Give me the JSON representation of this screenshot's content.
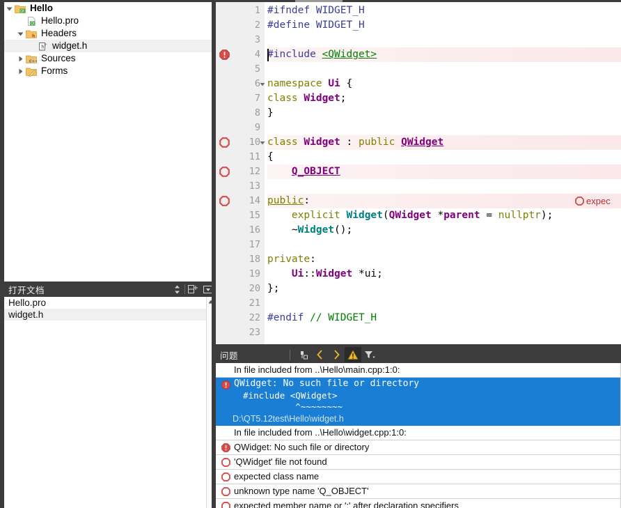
{
  "project_tree": {
    "items": [
      {
        "label": "Hello",
        "icon": "qt-folder-icon",
        "indent": 0,
        "arrow": "expanded",
        "bold": true,
        "selected": false
      },
      {
        "label": "Hello.pro",
        "icon": "qt-pro-file-icon",
        "indent": 1,
        "arrow": "none",
        "bold": false,
        "selected": false
      },
      {
        "label": "Headers",
        "icon": "headers-folder-icon",
        "indent": 1,
        "arrow": "expanded",
        "bold": false,
        "selected": false
      },
      {
        "label": "widget.h",
        "icon": "header-file-icon",
        "indent": 2,
        "arrow": "none",
        "bold": false,
        "selected": true
      },
      {
        "label": "Sources",
        "icon": "sources-folder-icon",
        "indent": 1,
        "arrow": "collapsed",
        "bold": false,
        "selected": false
      },
      {
        "label": "Forms",
        "icon": "forms-folder-icon",
        "indent": 1,
        "arrow": "collapsed",
        "bold": false,
        "selected": false
      }
    ]
  },
  "open_documents": {
    "title": "打开文档",
    "sort_icon": "sort-updown-icon",
    "add_icon": "split-add-icon",
    "menu_icon": "dropdown-box-icon",
    "items": [
      {
        "label": "Hello.pro",
        "selected": false
      },
      {
        "label": "widget.h",
        "selected": true
      }
    ]
  },
  "editor": {
    "filename": "widget.h",
    "caret_line": 4,
    "lines": [
      {
        "num": "1",
        "marker": "none",
        "fold": "none",
        "error": false,
        "tokens": [
          {
            "t": "#ifndef WIDGET_H",
            "c": "t-pre"
          }
        ]
      },
      {
        "num": "2",
        "marker": "none",
        "fold": "none",
        "error": false,
        "tokens": [
          {
            "t": "#define WIDGET_H",
            "c": "t-pre"
          }
        ]
      },
      {
        "num": "3",
        "marker": "none",
        "fold": "none",
        "error": false,
        "tokens": []
      },
      {
        "num": "4",
        "marker": "error-solid",
        "fold": "none",
        "error": true,
        "tokens": [
          {
            "t": "#include ",
            "c": "t-pre"
          },
          {
            "t": "<QWidget>",
            "c": "t-str"
          }
        ]
      },
      {
        "num": "5",
        "marker": "none",
        "fold": "none",
        "error": false,
        "tokens": []
      },
      {
        "num": "6",
        "marker": "none",
        "fold": "expanded",
        "error": false,
        "tokens": [
          {
            "t": "namespace ",
            "c": "t-kw"
          },
          {
            "t": "Ui",
            "c": "t-type"
          },
          {
            "t": " {",
            "c": "t-plain"
          }
        ]
      },
      {
        "num": "7",
        "marker": "none",
        "fold": "none",
        "error": false,
        "tokens": [
          {
            "t": "class ",
            "c": "t-kw"
          },
          {
            "t": "Widget",
            "c": "t-type"
          },
          {
            "t": ";",
            "c": "t-plain"
          }
        ]
      },
      {
        "num": "8",
        "marker": "none",
        "fold": "none",
        "error": false,
        "tokens": [
          {
            "t": "}",
            "c": "t-plain"
          }
        ]
      },
      {
        "num": "9",
        "marker": "none",
        "fold": "none",
        "error": false,
        "tokens": []
      },
      {
        "num": "10",
        "marker": "error-hollow",
        "fold": "expanded",
        "error": true,
        "tokens": [
          {
            "t": "class ",
            "c": "t-kw"
          },
          {
            "t": "Widget",
            "c": "t-type"
          },
          {
            "t": " : ",
            "c": "t-plain"
          },
          {
            "t": "public ",
            "c": "t-kw"
          },
          {
            "t": "QWidget",
            "c": "t-typeu"
          }
        ]
      },
      {
        "num": "11",
        "marker": "none",
        "fold": "none",
        "error": false,
        "tokens": [
          {
            "t": "{",
            "c": "t-plain"
          }
        ]
      },
      {
        "num": "12",
        "marker": "error-hollow",
        "fold": "none",
        "error": true,
        "tokens": [
          {
            "t": "    ",
            "c": "t-plain"
          },
          {
            "t": "Q_OBJECT",
            "c": "t-macro"
          }
        ]
      },
      {
        "num": "13",
        "marker": "none",
        "fold": "none",
        "error": false,
        "tokens": []
      },
      {
        "num": "14",
        "marker": "error-hollow",
        "fold": "none",
        "error": true,
        "tokens": [
          {
            "t": "public",
            "c": "t-lbl"
          },
          {
            "t": ":",
            "c": "t-plain"
          }
        ],
        "annotation": {
          "text": "expec",
          "icon": "error-hollow-icon"
        }
      },
      {
        "num": "15",
        "marker": "none",
        "fold": "none",
        "error": false,
        "tokens": [
          {
            "t": "    ",
            "c": "t-plain"
          },
          {
            "t": "explicit ",
            "c": "t-kw"
          },
          {
            "t": "Widget",
            "c": "t-fn"
          },
          {
            "t": "(",
            "c": "t-plain"
          },
          {
            "t": "QWidget ",
            "c": "t-type"
          },
          {
            "t": "*",
            "c": "t-plain"
          },
          {
            "t": "parent",
            "c": "t-type"
          },
          {
            "t": " = ",
            "c": "t-plain"
          },
          {
            "t": "nullptr",
            "c": "t-num"
          },
          {
            "t": ");",
            "c": "t-plain"
          }
        ]
      },
      {
        "num": "16",
        "marker": "none",
        "fold": "none",
        "error": false,
        "tokens": [
          {
            "t": "    ~",
            "c": "t-plain"
          },
          {
            "t": "Widget",
            "c": "t-fn"
          },
          {
            "t": "();",
            "c": "t-plain"
          }
        ]
      },
      {
        "num": "17",
        "marker": "none",
        "fold": "none",
        "error": false,
        "tokens": []
      },
      {
        "num": "18",
        "marker": "none",
        "fold": "none",
        "error": false,
        "tokens": [
          {
            "t": "private",
            "c": "t-kw"
          },
          {
            "t": ":",
            "c": "t-plain"
          }
        ]
      },
      {
        "num": "19",
        "marker": "none",
        "fold": "none",
        "error": false,
        "tokens": [
          {
            "t": "    ",
            "c": "t-plain"
          },
          {
            "t": "Ui",
            "c": "t-type"
          },
          {
            "t": "::",
            "c": "t-plain"
          },
          {
            "t": "Widget ",
            "c": "t-type"
          },
          {
            "t": "*ui;",
            "c": "t-plain"
          }
        ]
      },
      {
        "num": "20",
        "marker": "none",
        "fold": "none",
        "error": false,
        "tokens": [
          {
            "t": "};",
            "c": "t-plain"
          }
        ]
      },
      {
        "num": "21",
        "marker": "none",
        "fold": "none",
        "error": false,
        "tokens": []
      },
      {
        "num": "22",
        "marker": "none",
        "fold": "none",
        "error": false,
        "tokens": [
          {
            "t": "#endif ",
            "c": "t-pre"
          },
          {
            "t": "// WIDGET_H",
            "c": "t-com"
          }
        ]
      },
      {
        "num": "23",
        "marker": "none",
        "fold": "none",
        "error": false,
        "tokens": []
      }
    ]
  },
  "issues_panel": {
    "title": "问题",
    "toolbar": [
      {
        "name": "clear-icon",
        "active": false
      },
      {
        "name": "prev-icon",
        "active": false
      },
      {
        "name": "next-icon",
        "active": false
      },
      {
        "name": "warning-icon",
        "active": true
      },
      {
        "name": "filter-icon",
        "active": false
      }
    ],
    "rows": [
      {
        "icon": "none",
        "selected": false,
        "text": "In file included from ..\\Hello\\main.cpp:1:0:"
      },
      {
        "icon": "error-solid",
        "selected": true,
        "text": "QWidget: No such file or directory",
        "detail_lines": [
          "  #include <QWidget>",
          "            ^~~~~~~~~"
        ],
        "path": "D:\\QT5.12test\\Hello\\widget.h"
      },
      {
        "icon": "none",
        "selected": false,
        "text": "In file included from ..\\Hello\\widget.cpp:1:0:"
      },
      {
        "icon": "error-solid",
        "selected": false,
        "text": "QWidget: No such file or directory"
      },
      {
        "icon": "error-hollow",
        "selected": false,
        "text": "'QWidget' file not found"
      },
      {
        "icon": "error-hollow",
        "selected": false,
        "text": "expected class name"
      },
      {
        "icon": "error-hollow",
        "selected": false,
        "text": "unknown type name 'Q_OBJECT'"
      },
      {
        "icon": "error-hollow",
        "selected": false,
        "text": "expected member name or ';' after declaration specifiers"
      }
    ]
  },
  "colors": {
    "chrome_dark": "#3c3c3c",
    "selection_blue": "#1a7fd4",
    "error_red": "#d94a4a",
    "accent_yellow": "#e8b92a"
  }
}
